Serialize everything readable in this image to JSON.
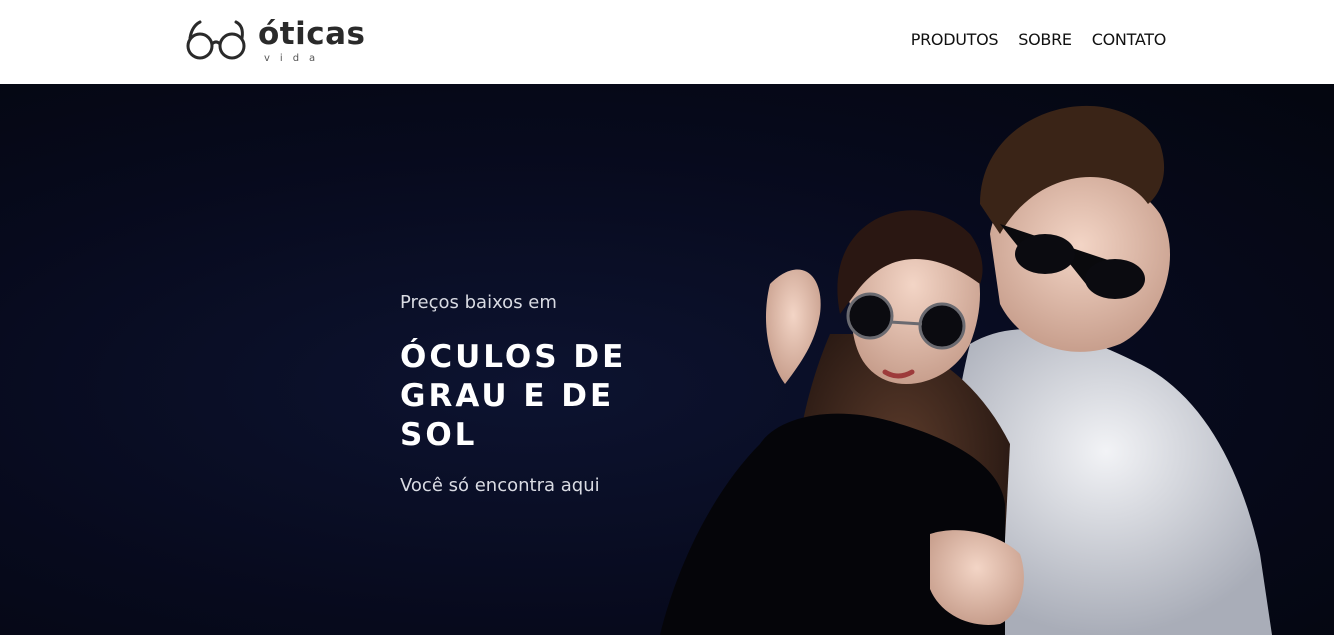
{
  "header": {
    "logo": {
      "wordmark": "óticas",
      "sub": "vida",
      "icon": "glasses-icon"
    },
    "nav": [
      {
        "label": "PRODUTOS"
      },
      {
        "label": "SOBRE"
      },
      {
        "label": "CONTATO"
      }
    ]
  },
  "hero": {
    "pre": "Preços baixos em",
    "title": "ÓCULOS DE GRAU E DE SOL",
    "sub": "Você só encontra aqui",
    "colors": {
      "background": "#070a1d",
      "title": "#ffffff",
      "text": "#d9dbe3"
    }
  }
}
